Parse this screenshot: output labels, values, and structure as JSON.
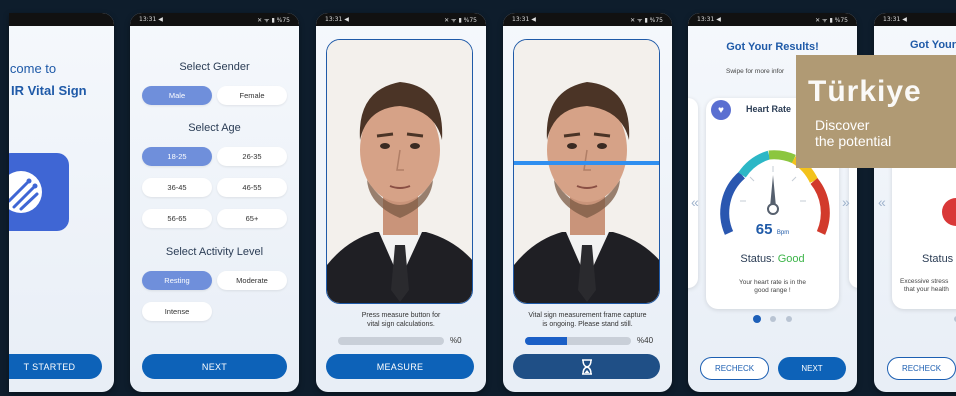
{
  "screen1": {
    "title_line1": "lcome to",
    "title_line2": "IR Vital Sign",
    "button": "T STARTED"
  },
  "screen2": {
    "status": "13:31 ◀",
    "gender_title": "Select Gender",
    "genders": [
      "Male",
      "Female"
    ],
    "age_title": "Select Age",
    "ages": [
      "18-25",
      "26-35",
      "36-45",
      "46-55",
      "56-65",
      "65+"
    ],
    "activity_title": "Select Activity Level",
    "activities": [
      "Resting",
      "Moderate",
      "Intense"
    ],
    "button": "NEXT"
  },
  "screen3": {
    "status": "13:31 ◀",
    "caption1": "Press measure button for",
    "caption2": "vital sign calculations.",
    "progress_label": "%0",
    "progress": 0,
    "button": "MEASURE"
  },
  "screen4": {
    "status": "13:31 ◀",
    "caption1": "Vital sign measurement frame capture",
    "caption2": "is ongoing. Please stand still.",
    "progress_label": "%40",
    "progress": 0.4,
    "button_icon": "hourglass-icon"
  },
  "screen5": {
    "status": "13:31 ◀",
    "title": "Got Your Results!",
    "subtitle": "Swipe for more infor",
    "card_title": "Heart Rate",
    "bpm": "65",
    "bpm_unit": "Bpm",
    "status_label": "Status:",
    "status_value": "Good",
    "note1": "Your heart rate is in the",
    "note2": "good range !",
    "recheck": "RECHECK",
    "next": "NEXT"
  },
  "screen6": {
    "status": "13:31 ◀",
    "title": "Got Your",
    "status_label": "Status",
    "note1": "Excessive stress",
    "note2": "that your health",
    "recheck": "RECHECK"
  },
  "ad": {
    "brand": "Türkiye",
    "line1": "Discover",
    "line2": "the potential"
  },
  "colors": {
    "primary": "#0d62b8",
    "selected_chip": "#6f8fdb",
    "good": "#3db54a",
    "ad_bg": "#b09a74"
  }
}
